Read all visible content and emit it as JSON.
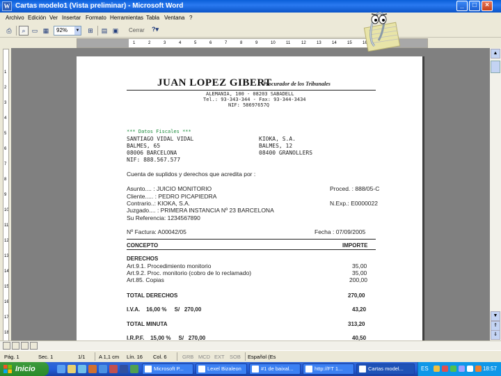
{
  "window": {
    "title": "Cartas modelo1 (Vista preliminar) - Microsoft Word"
  },
  "menu": [
    "Archivo",
    "Edición",
    "Ver",
    "Insertar",
    "Formato",
    "Herramientas",
    "Tabla",
    "Ventana",
    "?"
  ],
  "toolbar": {
    "zoom": "92%",
    "close_label": "Cerrar"
  },
  "ruler": {
    "h_ticks": [
      "1",
      "2",
      "3",
      "4",
      "5",
      "6",
      "7",
      "8",
      "9",
      "10",
      "11",
      "12",
      "13",
      "14",
      "15",
      "16"
    ],
    "v_ticks": [
      "1",
      "2",
      "3",
      "4",
      "5",
      "6",
      "7",
      "8",
      "9",
      "10",
      "11",
      "12",
      "13",
      "14",
      "15",
      "16",
      "17",
      "18"
    ]
  },
  "letter": {
    "name": "JUAN LOPEZ GIBERT",
    "role": "Procurador de los Tribunales",
    "address": "ALEMANIA, 100 - 08203 SABADELL",
    "phone": "Tel.: 93-343-344 - Fax: 93-344-3434",
    "nif": "NIF: 58697657Q",
    "fiscal_title": "*** Datos Fiscales ***",
    "client_block": [
      "SANTIAGO VIDAL VIDAL",
      "BALMES, 65",
      "08006 BARCELONA",
      "NIF: 888.567.577"
    ],
    "other_block": [
      "KIOKA, S.A.",
      "BALMES, 12",
      "08400 GRANOLLERS"
    ],
    "intro": "Cuenta de suplidos y derechos que acredita por :",
    "asunto": "Asunto.... : JUICIO MONITORIO",
    "proced": "Proced. : 888/05-C",
    "cliente": "Cliente..... : PEDRO PICAPIEDRA",
    "contrario": "Contrario..: KIOKA, S.A.",
    "nexp": "N.Exp.: E0000022",
    "juzgado": "Juzgado.... : PRIMERA INSTANCIA Nº 23 BARCELONA",
    "referencia": "Su Referencia: 1234567890",
    "factura": "Nº Factura: A00042/05",
    "fecha": "Fecha : 07/09/2005",
    "col_concepto": "CONCEPTO",
    "col_importe": "IMPORTE",
    "derechos": "DERECHOS",
    "lines": [
      {
        "label": "Art.9.1. Procedimiento monitorio",
        "value": "35,00"
      },
      {
        "label": "Art.9.2. Proc. monitorio (cobro de lo reclamado)",
        "value": "35,00"
      },
      {
        "label": "Art.85. Copias",
        "value": "200,00"
      }
    ],
    "total_derechos_label": "TOTAL DERECHOS",
    "total_derechos_value": "270,00",
    "iva_label": "I.V.A.    16,00 %     S/   270,00",
    "iva_value": "43,20",
    "total_minuta_label": "TOTAL MINUTA",
    "total_minuta_value": "313,20",
    "irpf_label": "I.R.P.F.    15,00 %     S/   270,00",
    "irpf_value": "40,50"
  },
  "status": {
    "pag": "Pág. 1",
    "sec": "Sec. 1",
    "pages": "1/1",
    "a": "A 1,1 cm",
    "lin": "Lín. 16",
    "col": "Col. 6",
    "grb": "GRB",
    "mcd": "MCD",
    "ext": "EXT",
    "sob": "SOB",
    "lang": "Español (Es"
  },
  "taskbar": {
    "start": "Inicio",
    "tasks": [
      "Microsoft P...",
      "Lexel Bizaleon",
      "#1 de baixal...",
      "http://FT 1...",
      "Cartas model..."
    ],
    "lang": "ES",
    "clock": "18:57"
  },
  "colors": {
    "titlebar": "#0a5fd8",
    "fiscal": "#1a8a3a",
    "taskbar": "#245edb",
    "start": "#3c9b3c"
  }
}
